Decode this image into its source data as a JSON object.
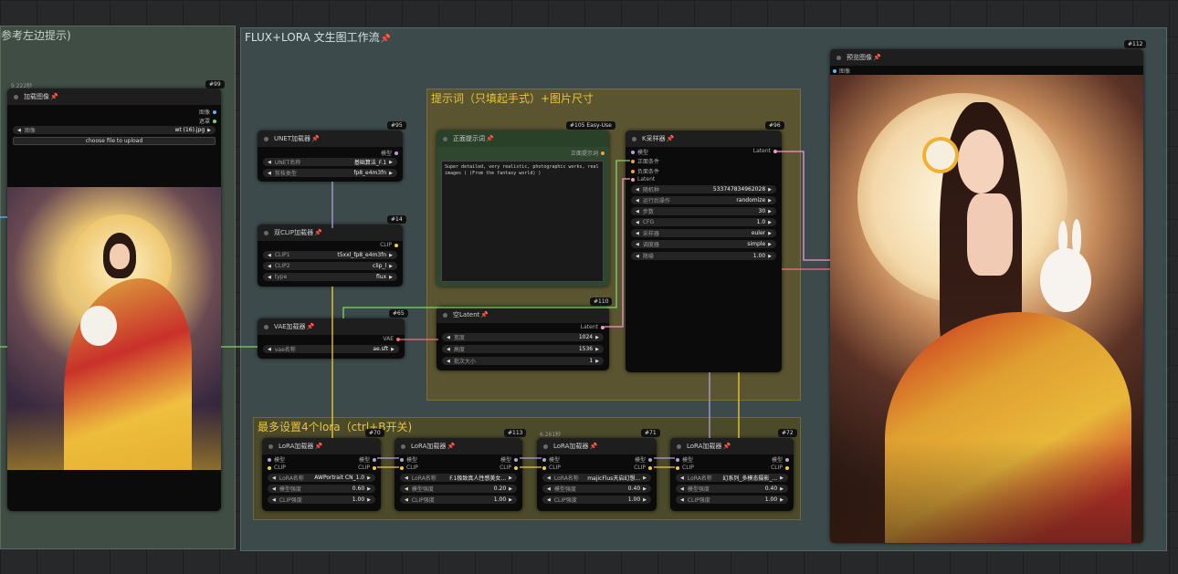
{
  "groups": {
    "left": {
      "title": "参考左边提示)"
    },
    "main": {
      "title": "FLUX+LORA 文生图工作流"
    },
    "prompt": {
      "title": "提示词（只填起手式）+图片尺寸"
    },
    "lora": {
      "title": "最多设置4个lora（ctrl+B开关)"
    }
  },
  "pin_icon": "📌",
  "colors": {
    "main_group": "#3c4a4b",
    "prompt_group": "#5a5430",
    "lora_group": "#4b4a2a",
    "prompt_node": "#2e472e",
    "wire_model": "#b49fd9",
    "wire_clip": "#f2d030",
    "wire_vae": "#f07079",
    "wire_latent": "#f199c6",
    "wire_image": "#7fd46c",
    "wire_cond": "#f0a040"
  },
  "nodes": {
    "load_image": {
      "id": "#99",
      "timer": "9.222秒",
      "title": "加载图像",
      "outputs": [
        "图像",
        "遮罩"
      ],
      "widget": {
        "label": "图像",
        "value": "wt (16).jpg"
      },
      "upload_button": "choose file to upload"
    },
    "unet": {
      "id": "#95",
      "title": "UNET加载器",
      "output": "模型",
      "widgets": [
        {
          "label": "UNET名称",
          "value": "基础算法_F.1"
        },
        {
          "label": "剪枝类型",
          "value": "fp8_e4m3fn"
        }
      ]
    },
    "dual_clip": {
      "id": "#14",
      "title": "双CLIP加载器",
      "output": "CLIP",
      "widgets": [
        {
          "label": "CLIP1",
          "value": "t5xxl_fp8_e4m3fn"
        },
        {
          "label": "CLIP2",
          "value": "clip_l"
        },
        {
          "label": "type",
          "value": "flux"
        }
      ]
    },
    "vae": {
      "id": "#65",
      "title": "VAE加载器",
      "output": "VAE",
      "widgets": [
        {
          "label": "vae名称",
          "value": "ae.sft"
        }
      ]
    },
    "prompt": {
      "id": "#105 Easy-Use",
      "title": "正面提示词",
      "output": "正面提示词",
      "text": "Super detailed, very realistic, photographic works, real images ( (From the fantasy world) )"
    },
    "latent": {
      "id": "#110",
      "title": "空Latent",
      "output": "Latent",
      "widgets": [
        {
          "label": "宽度",
          "value": "1024"
        },
        {
          "label": "高度",
          "value": "1536"
        },
        {
          "label": "批次大小",
          "value": "1"
        }
      ]
    },
    "ksampler": {
      "id": "#96",
      "title": "K采样器",
      "output": "Latent",
      "inputs": [
        "模型",
        "正面条件",
        "负面条件",
        "Latent"
      ],
      "widgets": [
        {
          "label": "随机种",
          "value": "533747834962028"
        },
        {
          "label": "运行后操作",
          "value": "randomize"
        },
        {
          "label": "步数",
          "value": "30"
        },
        {
          "label": "CFG",
          "value": "1.0"
        },
        {
          "label": "采样器",
          "value": "euler"
        },
        {
          "label": "调度器",
          "value": "simple"
        },
        {
          "label": "降噪",
          "value": "1.00"
        }
      ]
    },
    "preview": {
      "id": "#112",
      "title": "预览图像",
      "input": "图像"
    },
    "loras": [
      {
        "id": "#70",
        "timer": "",
        "title": "LoRA加载器",
        "lora_name": "AWPortrait CN_1.0",
        "model_strength": "0.60",
        "clip_strength": "1.00"
      },
      {
        "id": "#113",
        "timer": "",
        "title": "LoRA加载器",
        "lora_name": "F.1极致真人性感美女...",
        "model_strength": "0.20",
        "clip_strength": "1.00"
      },
      {
        "id": "#71",
        "timer": "6.261秒",
        "title": "LoRA加载器",
        "lora_name": "majicFlus天启幻想...",
        "model_strength": "0.40",
        "clip_strength": "1.00"
      },
      {
        "id": "#72",
        "timer": "",
        "title": "LoRA加载器",
        "lora_name": "幻系列_多模态摄影_...",
        "model_strength": "0.40",
        "clip_strength": "1.00"
      }
    ],
    "lora_labels": {
      "model": "模型",
      "clip": "CLIP",
      "lora_name": "LoRA名称",
      "model_strength": "模型强度",
      "clip_strength": "CLIP强度"
    }
  }
}
